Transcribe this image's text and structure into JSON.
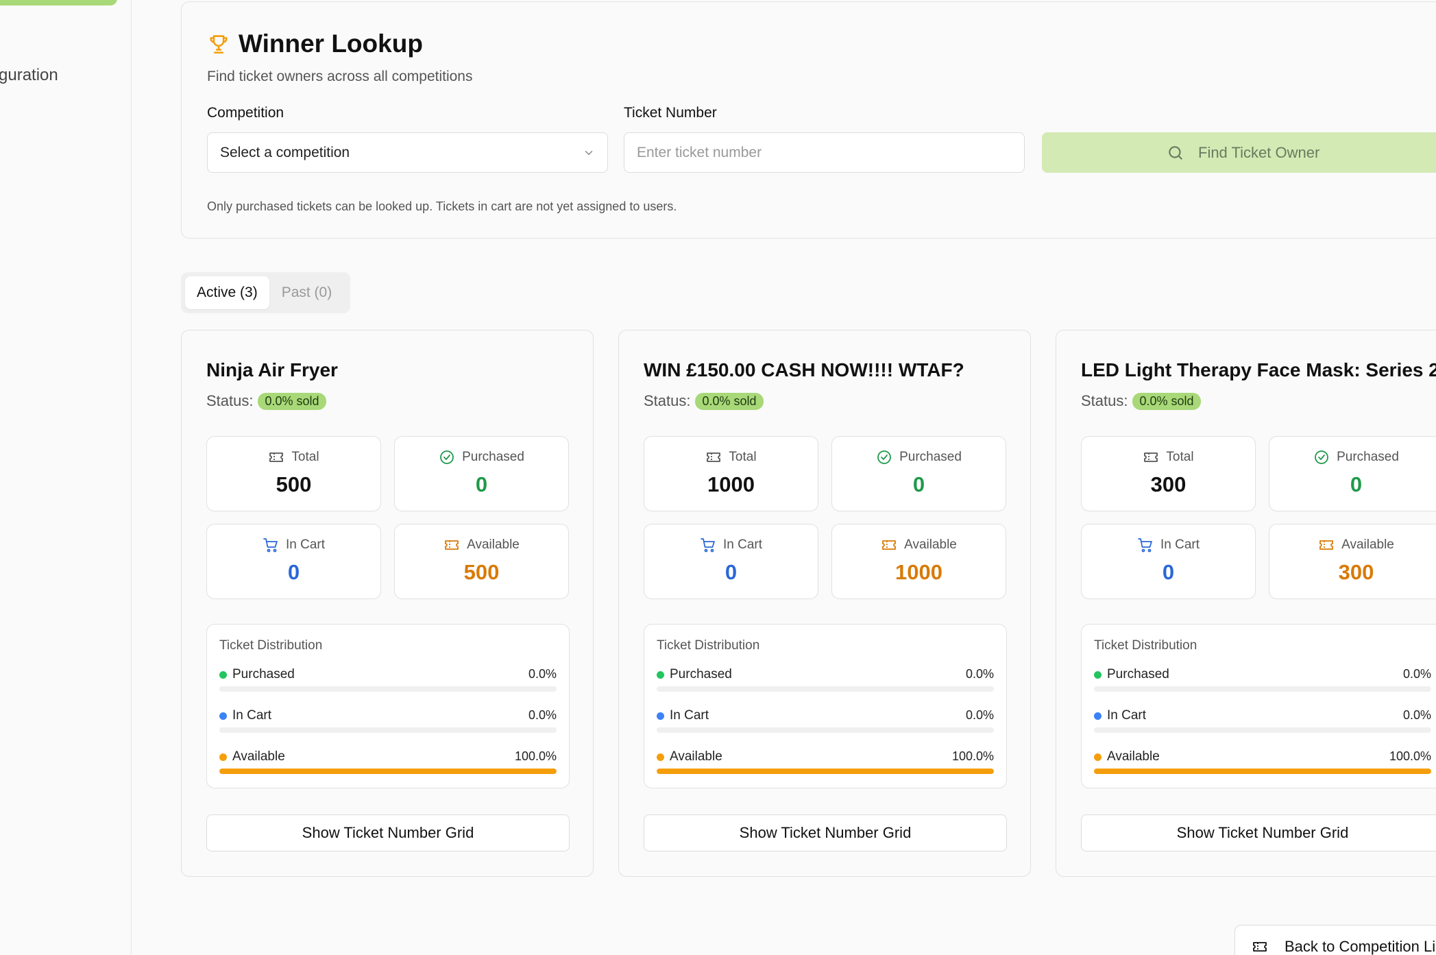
{
  "sidebar": {
    "partial_item_label": "guration"
  },
  "lookup": {
    "title": "Winner Lookup",
    "subtitle": "Find ticket owners across all competitions",
    "competition_label": "Competition",
    "competition_value": "Select a competition",
    "ticket_label": "Ticket Number",
    "ticket_placeholder": "Enter ticket number",
    "find_button": "Find Ticket Owner",
    "note": "Only purchased tickets can be looked up. Tickets in cart are not yet assigned to users."
  },
  "tabs": [
    {
      "label": "Active (3)",
      "active": true
    },
    {
      "label": "Past (0)",
      "active": false
    }
  ],
  "labels": {
    "status": "Status:",
    "total": "Total",
    "purchased": "Purchased",
    "in_cart": "In Cart",
    "available": "Available",
    "distribution": "Ticket Distribution",
    "grid_button": "Show Ticket Number Grid"
  },
  "competitions": [
    {
      "title": "Ninja Air Fryer",
      "badge": "0.0% sold",
      "total": "500",
      "purchased": "0",
      "in_cart": "0",
      "available": "500",
      "purchased_pct_label": "0.0%",
      "in_cart_pct_label": "0.0%",
      "available_pct_label": "100.0%",
      "purchased_pct": 0,
      "in_cart_pct": 0,
      "available_pct": 100
    },
    {
      "title": "WIN £150.00 CASH NOW!!!! WTAF?",
      "badge": "0.0% sold",
      "total": "1000",
      "purchased": "0",
      "in_cart": "0",
      "available": "1000",
      "purchased_pct_label": "0.0%",
      "in_cart_pct_label": "0.0%",
      "available_pct_label": "100.0%",
      "purchased_pct": 0,
      "in_cart_pct": 0,
      "available_pct": 100
    },
    {
      "title": "LED Light Therapy Face Mask: Series 2",
      "badge": "0.0% sold",
      "total": "300",
      "purchased": "0",
      "in_cart": "0",
      "available": "300",
      "purchased_pct_label": "0.0%",
      "in_cart_pct_label": "0.0%",
      "available_pct_label": "100.0%",
      "purchased_pct": 0,
      "in_cart_pct": 0,
      "available_pct": 100
    }
  ],
  "back_button": "Back to Competition Li",
  "colors": {
    "accent_green": "#a8d878",
    "find_button_bg": "#d4eab4",
    "purchased": "#22c55e",
    "in_cart": "#3b82f6",
    "available": "#f59e0b",
    "trophy": "#f59e0b"
  },
  "icons": {
    "title": "trophy-icon",
    "search": "search-icon",
    "total": "ticket-icon",
    "purchased": "check-circle-icon",
    "in_cart": "cart-icon",
    "available": "ticket-icon",
    "select": "chevron-down-icon",
    "back": "ticket-icon"
  }
}
